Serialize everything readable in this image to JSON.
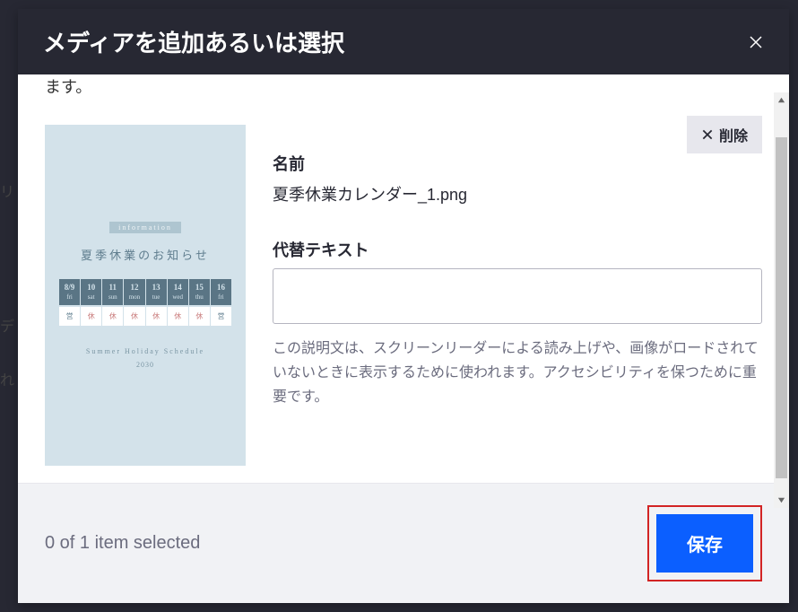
{
  "modal": {
    "title": "メディアを追加あるいは選択",
    "partial_text": "ます。"
  },
  "thumbnail": {
    "info_badge": "information",
    "title": "夏季休業のお知らせ",
    "calendar_days": [
      {
        "date": "8/9",
        "dow": "fri"
      },
      {
        "date": "10",
        "dow": "sat"
      },
      {
        "date": "11",
        "dow": "sun"
      },
      {
        "date": "12",
        "dow": "mon"
      },
      {
        "date": "13",
        "dow": "tue"
      },
      {
        "date": "14",
        "dow": "wed"
      },
      {
        "date": "15",
        "dow": "thu"
      },
      {
        "date": "16",
        "dow": "fri"
      }
    ],
    "status": [
      "営",
      "休",
      "休",
      "休",
      "休",
      "休",
      "休",
      "営"
    ],
    "subtitle": "Summer Holiday Schedule",
    "year": "2030"
  },
  "details": {
    "delete_label": "削除",
    "name_label": "名前",
    "name_value": "夏季休業カレンダー_1.png",
    "alt_label": "代替テキスト",
    "alt_value": "",
    "help_text": "この説明文は、スクリーンリーダーによる読み上げや、画像がロードされていないときに表示するために使われます。アクセシビリティを保つために重要です。"
  },
  "footer": {
    "selection": "0 of 1 item selected",
    "save_label": "保存"
  }
}
